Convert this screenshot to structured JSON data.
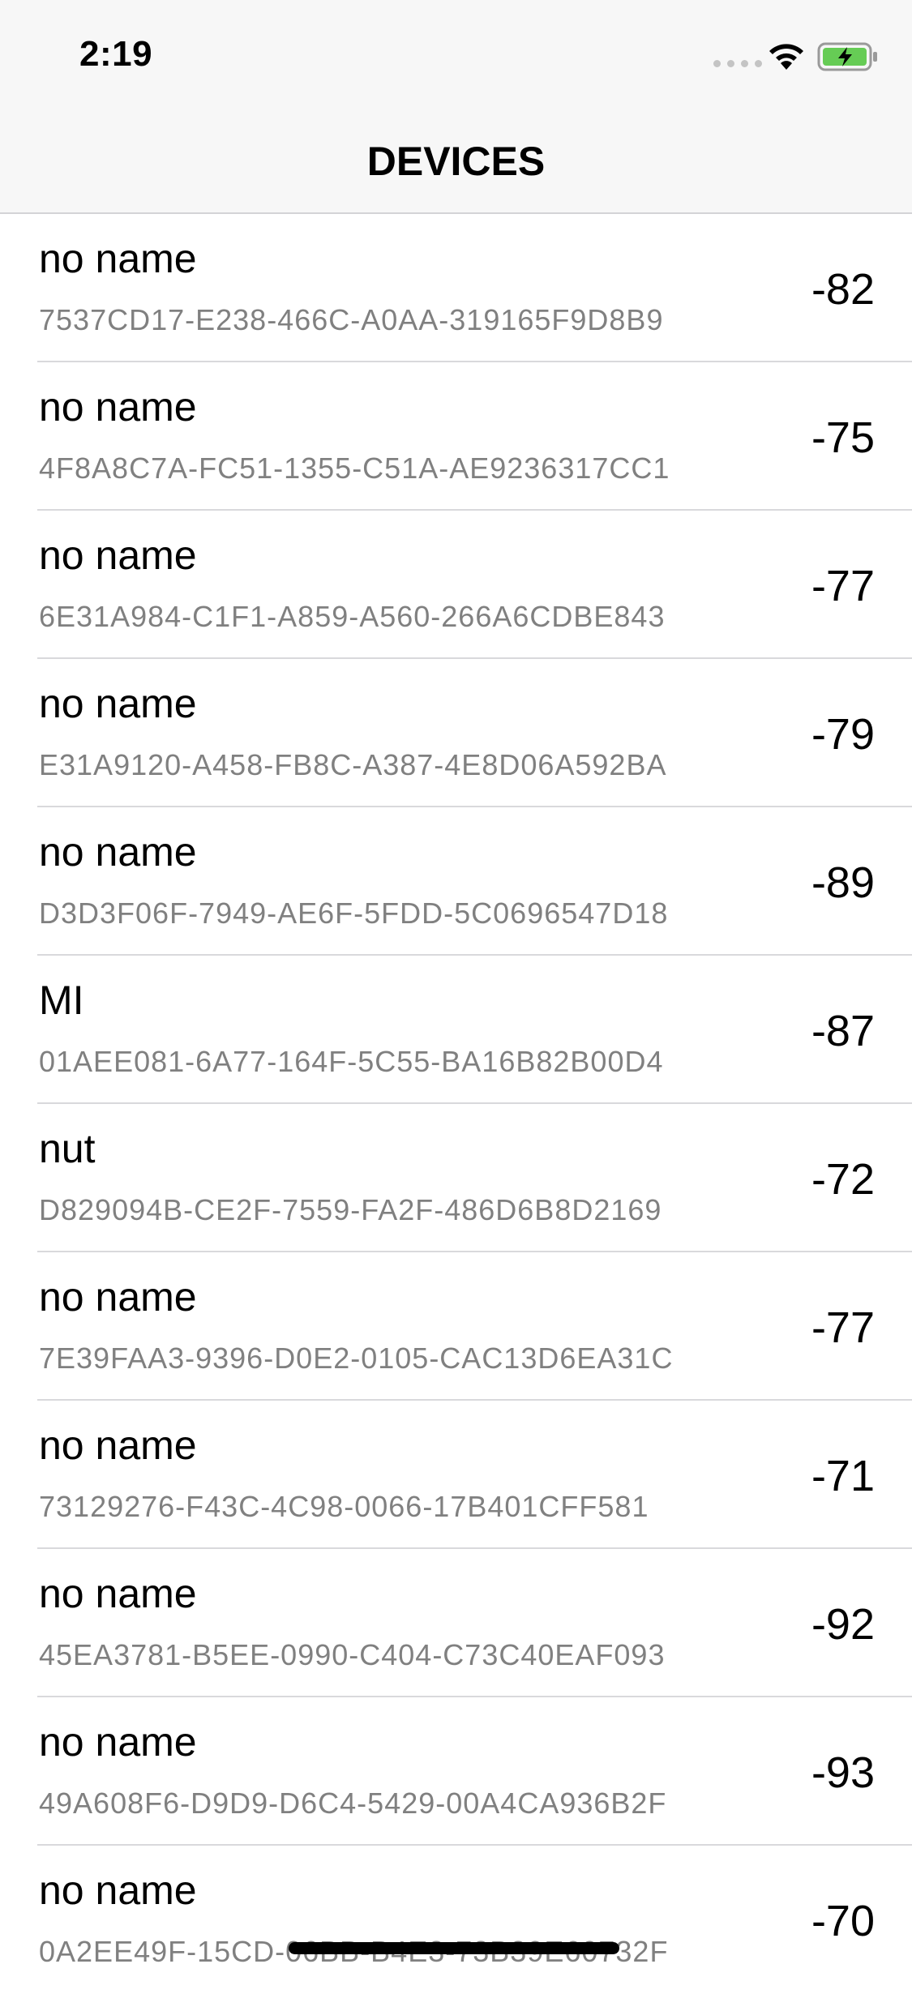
{
  "status_bar": {
    "time": "2:19",
    "icons": [
      "cellular-signal-icon",
      "wifi-icon",
      "battery-charging-icon"
    ],
    "battery_color": "#66cc55"
  },
  "nav": {
    "title": "DEVICES"
  },
  "devices": [
    {
      "name": "no name",
      "uuid": "7537CD17-E238-466C-A0AA-319165F9D8B9",
      "rssi": "-82"
    },
    {
      "name": "no name",
      "uuid": "4F8A8C7A-FC51-1355-C51A-AE9236317CC1",
      "rssi": "-75"
    },
    {
      "name": "no name",
      "uuid": "6E31A984-C1F1-A859-A560-266A6CDBE843",
      "rssi": "-77"
    },
    {
      "name": "no name",
      "uuid": "E31A9120-A458-FB8C-A387-4E8D06A592BA",
      "rssi": "-79"
    },
    {
      "name": "no name",
      "uuid": "D3D3F06F-7949-AE6F-5FDD-5C0696547D18",
      "rssi": "-89"
    },
    {
      "name": "MI",
      "uuid": "01AEE081-6A77-164F-5C55-BA16B82B00D4",
      "rssi": "-87"
    },
    {
      "name": "nut",
      "uuid": "D829094B-CE2F-7559-FA2F-486D6B8D2169",
      "rssi": "-72"
    },
    {
      "name": "no name",
      "uuid": "7E39FAA3-9396-D0E2-0105-CAC13D6EA31C",
      "rssi": "-77"
    },
    {
      "name": "no name",
      "uuid": "73129276-F43C-4C98-0066-17B401CFF581",
      "rssi": "-71"
    },
    {
      "name": "no name",
      "uuid": "45EA3781-B5EE-0990-C404-C73C40EAF093",
      "rssi": "-92"
    },
    {
      "name": "no name",
      "uuid": "49A608F6-D9D9-D6C4-5429-00A4CA936B2F",
      "rssi": "-93"
    },
    {
      "name": "no name",
      "uuid": "0A2EE49F-15CD-06BB-B4E3-73B39E60732F",
      "rssi": "-70"
    }
  ]
}
